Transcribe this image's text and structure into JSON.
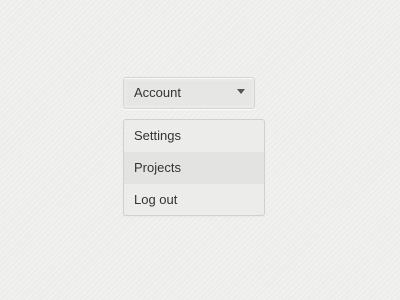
{
  "dropdown": {
    "toggle_label": "Account",
    "caret_icon": "caret-down-icon",
    "items": [
      {
        "label": "Settings",
        "highlighted": false
      },
      {
        "label": "Projects",
        "highlighted": true
      },
      {
        "label": "Log out",
        "highlighted": false
      }
    ]
  },
  "colors": {
    "background": "#eeeeec",
    "text": "#333333",
    "highlight": "#e3e3e1",
    "border": "#d0d0ce"
  }
}
